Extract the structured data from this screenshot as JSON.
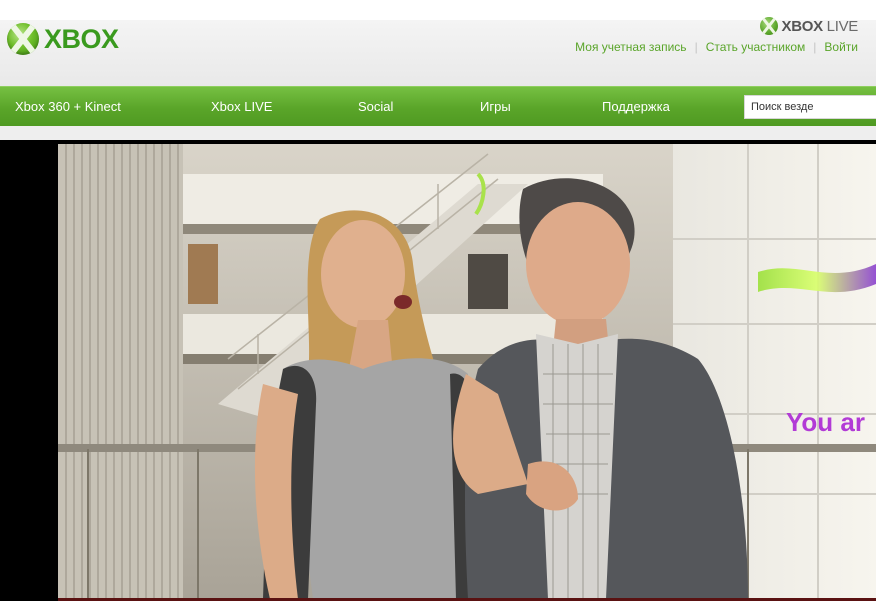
{
  "brand": {
    "logo_text": "XBOX",
    "live_logo_xbox": "XBOX",
    "live_logo_live": " LIVE"
  },
  "account": {
    "links": [
      "Моя учетная запись",
      "Стать участником",
      "Войти"
    ]
  },
  "nav": {
    "items": [
      "Xbox 360 + Kinect",
      "Xbox LIVE",
      "Social",
      "Игры",
      "Поддержка"
    ]
  },
  "search": {
    "value": "Поиск везде"
  },
  "video": {
    "overlay_text": "You ar",
    "progress_percent": 0
  },
  "colors": {
    "brand_green": "#5aa529",
    "link_green": "#5aa52a",
    "overlay_purple": "#b23bd6"
  },
  "icons": {
    "xbox_logo": "xbox-sphere-icon",
    "live_logo": "xbox-live-icon"
  }
}
